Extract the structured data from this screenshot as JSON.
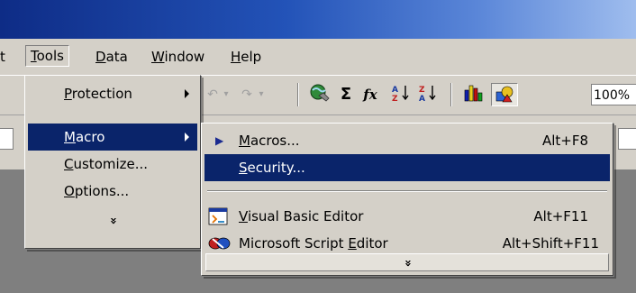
{
  "menubar": {
    "cut_item": "t",
    "tools": {
      "key": "T",
      "rest": "ools"
    },
    "data": {
      "key": "D",
      "rest": "ata"
    },
    "window": {
      "key": "W",
      "rest": "indow"
    },
    "help": {
      "key": "H",
      "rest": "elp"
    }
  },
  "toolbar": {
    "zoom": "100%",
    "sigma": "Σ",
    "fx": "fx"
  },
  "tools_menu": {
    "protection": {
      "key": "P",
      "rest": "rotection"
    },
    "macro": {
      "key": "M",
      "rest": "acro"
    },
    "customize": {
      "key": "C",
      "rest": "ustomize..."
    },
    "options": {
      "key": "O",
      "rest": "ptions..."
    },
    "expand": "»"
  },
  "macro_menu": {
    "macros": {
      "key": "M",
      "rest": "acros...",
      "shortcut": "Alt+F8"
    },
    "security": {
      "key": "S",
      "rest": "ecurity..."
    },
    "vbe": {
      "key": "V",
      "rest": "isual Basic Editor",
      "shortcut": "Alt+F11"
    },
    "mse": {
      "pre": "Microsoft Script ",
      "key": "E",
      "rest": "ditor",
      "shortcut": "Alt+Shift+F11"
    },
    "expand": "»"
  }
}
